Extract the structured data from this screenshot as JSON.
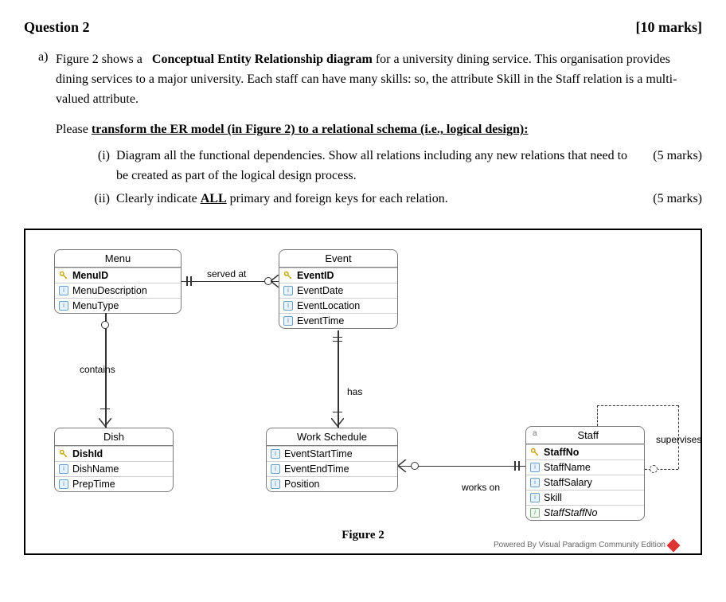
{
  "question": {
    "number": "Question 2",
    "marks": "[10 marks]"
  },
  "prompt": {
    "part_letter": "a)",
    "line1_pre": "Figure 2 shows a ",
    "line1_bold": "Conceptual Entity Relationship diagram",
    "line1_post": " for a university dining service. This organisation provides dining services to a major university. Each staff can have many skills: so, the attribute Skill in the Staff relation is a multi-valued attribute."
  },
  "instruction": {
    "pre": "Please ",
    "underline_bold": "transform the ER model (in Figure 2) to a relational schema (i.e., logical design):"
  },
  "subparts": {
    "i": {
      "roman": "(i)",
      "text": "Diagram all the functional dependencies. Show all relations including any new relations that need to be created as part of the logical design process.",
      "marks": "(5 marks)"
    },
    "ii": {
      "roman": "(ii)",
      "text_pre": "Clearly indicate ",
      "text_bold_u": "ALL",
      "text_post": " primary and foreign keys for each relation.",
      "marks": "(5 marks)"
    }
  },
  "diagram": {
    "caption": "Figure 2",
    "footer": "Powered By  Visual Paradigm Community Edition",
    "entities": {
      "menu": {
        "name": "Menu",
        "pk": "MenuID",
        "attrs": [
          "MenuDescription",
          "MenuType"
        ]
      },
      "event": {
        "name": "Event",
        "pk": "EventID",
        "attrs": [
          "EventDate",
          "EventLocation",
          "EventTime"
        ]
      },
      "dish": {
        "name": "Dish",
        "pk": "DishId",
        "attrs": [
          "DishName",
          "PrepTime"
        ]
      },
      "work": {
        "name": "Work Schedule",
        "attrs": [
          "EventStartTime",
          "EventEndTime",
          "Position"
        ]
      },
      "staff": {
        "name": "Staff",
        "pk": "StaffNo",
        "attrs": [
          "StaffName",
          "StaffSalary",
          "Skill"
        ],
        "fk": "StaffStaffNo",
        "role": "a"
      }
    },
    "relationships": {
      "served_at": "served at",
      "contains": "contains",
      "has": "has",
      "works_on": "works on",
      "supervises": "supervises"
    }
  }
}
